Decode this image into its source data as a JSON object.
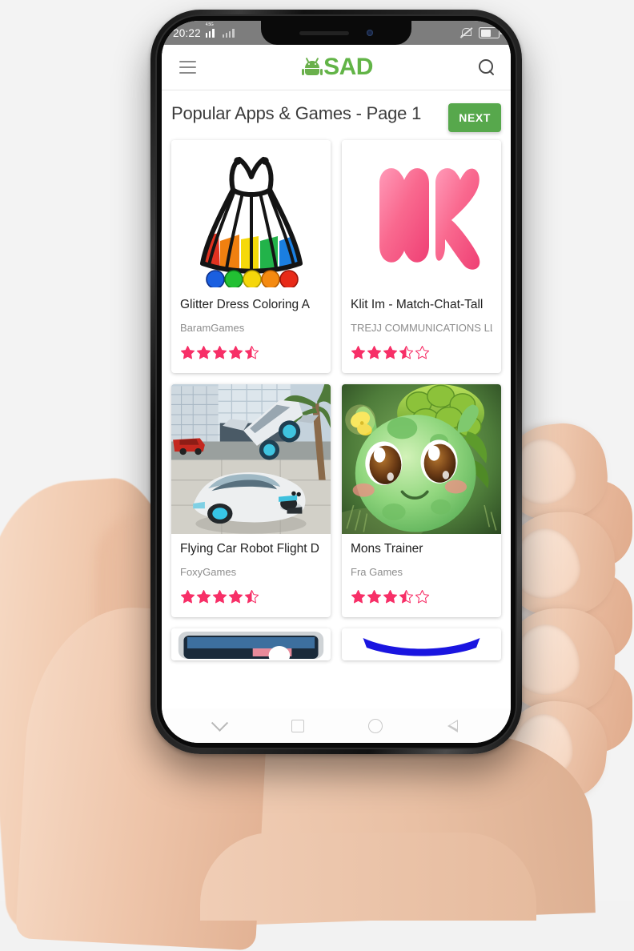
{
  "status_bar": {
    "time": "20:22",
    "network_label": "4.5G",
    "signal_icon": "signal-bars-icon",
    "mute_icon": "bell-muted-icon",
    "battery_icon": "battery-icon",
    "battery_level_pct": 52
  },
  "app_bar": {
    "menu_icon": "hamburger-menu-icon",
    "logo_icon": "android-robot-icon",
    "brand": "SAD",
    "search_icon": "search-icon",
    "brand_color": "#62b447"
  },
  "page": {
    "title": "Popular Apps & Games - Page 1",
    "next_label": "NEXT",
    "next_color": "#57a84c"
  },
  "apps": [
    {
      "name": "Glitter Dress Coloring A",
      "developer": "BaramGames",
      "rating": 4.5,
      "thumb": "dress-coloring-icon"
    },
    {
      "name": "Klit Im - Match-Chat-Tall",
      "developer": "TREJJ COMMUNICATIONS LLC",
      "rating": 3.5,
      "thumb": "ik-pink-logo-icon"
    },
    {
      "name": "Flying Car Robot Flight D",
      "developer": "FoxyGames",
      "rating": 4.5,
      "thumb": "flying-car-screenshot"
    },
    {
      "name": "Mons Trainer",
      "developer": "Fra Games",
      "rating": 3.5,
      "thumb": "green-monster-icon"
    }
  ],
  "star_color": "#f72f67",
  "nav_bar": {
    "items": [
      {
        "icon": "chevron-down-icon"
      },
      {
        "icon": "recents-square-icon"
      },
      {
        "icon": "home-circle-icon"
      },
      {
        "icon": "back-triangle-icon"
      }
    ]
  }
}
